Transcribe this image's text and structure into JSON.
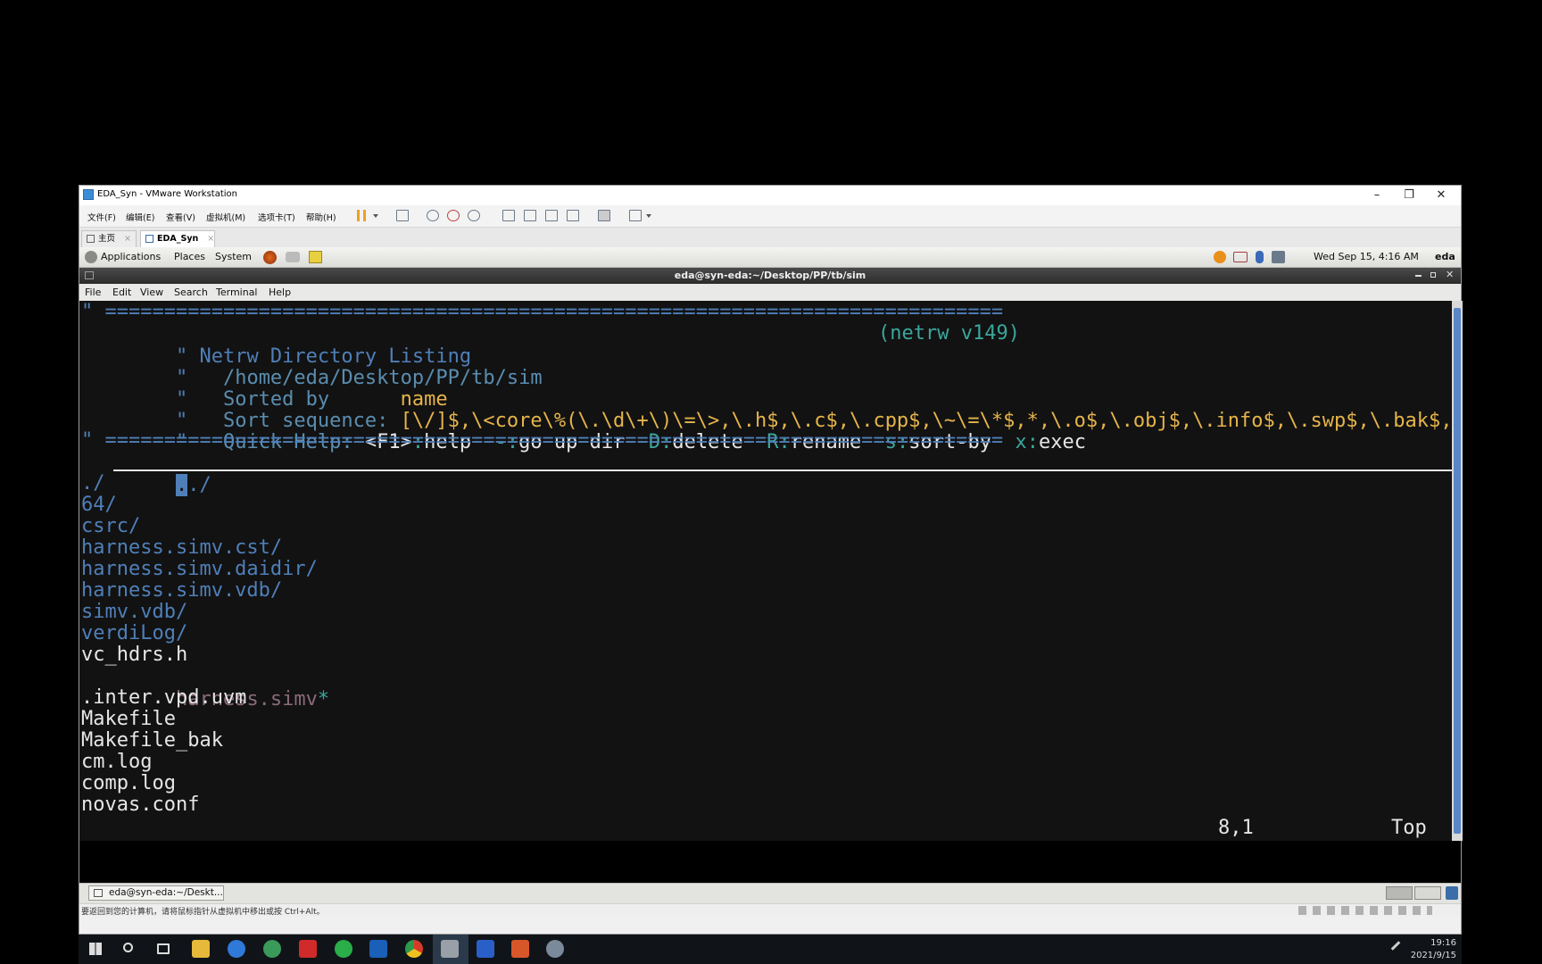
{
  "vmware": {
    "title": "EDA_Syn - VMware Workstation",
    "menu": [
      "文件(F)",
      "编辑(E)",
      "查看(V)",
      "虚拟机(M)",
      "选项卡(T)",
      "帮助(H)"
    ],
    "tabs": [
      {
        "label": "主页",
        "close": "×"
      },
      {
        "label": "EDA_Syn",
        "close": "×"
      }
    ],
    "window_buttons": {
      "minimize": "–",
      "restore": "❐",
      "close": "✕"
    },
    "status_text": "要返回到您的计算机，请将鼠标指针从虚拟机中移出或按 Ctrl+Alt。"
  },
  "gnome_panel": {
    "applications": "Applications",
    "places": "Places",
    "system": "System",
    "datetime": "Wed Sep 15, 4:16 AM",
    "user": "eda"
  },
  "terminal": {
    "title": "eda@syn-eda:~/Desktop/PP/tb/sim",
    "menu": [
      "File",
      "Edit",
      "View",
      "Search",
      "Terminal",
      "Help"
    ],
    "header": {
      "rule": "\" ============================================================================",
      "listing_title": "\" Netrw Directory Listing",
      "version": "(netrw v149)",
      "path_prefix": "\"   ",
      "path": "/home/eda/Desktop/PP/tb/sim",
      "sorted_prefix": "\"   ",
      "sorted_label": "Sorted by      ",
      "sorted_value": "name",
      "seq_prefix": "\"   ",
      "seq_label": "Sort sequence: ",
      "seq_value": "[\\/]$,\\<core\\%(\\.\\d\\+\\)\\=\\>,\\.h$,\\.c$,\\.cpp$,\\~\\=\\*$,*,\\.o$,\\.obj$,\\.info$,\\.swp$,\\.bak$,\\~$",
      "help_prefix": "\"   ",
      "help_label": "Quick Help: ",
      "help_items": [
        {
          "key": "<F1>",
          "sep": ":",
          "text": "help  "
        },
        {
          "key": "-",
          "sep": ":",
          "text": "go up dir  "
        },
        {
          "key": "D",
          "sep": ":",
          "text": "delete  "
        },
        {
          "key": "R",
          "sep": ":",
          "text": "rename  "
        },
        {
          "key": "s",
          "sep": ":",
          "text": "sort-by  "
        },
        {
          "key": "x",
          "sep": ":",
          "text": "exec"
        }
      ]
    },
    "current_line": {
      "cursor_char": ".",
      "rest": "./"
    },
    "entries": [
      {
        "name": "./",
        "kind": "dir"
      },
      {
        "name": "64/",
        "kind": "dir"
      },
      {
        "name": "csrc/",
        "kind": "dir"
      },
      {
        "name": "harness.simv.cst/",
        "kind": "dir"
      },
      {
        "name": "harness.simv.daidir/",
        "kind": "dir"
      },
      {
        "name": "harness.simv.vdb/",
        "kind": "dir"
      },
      {
        "name": "simv.vdb/",
        "kind": "dir"
      },
      {
        "name": "verdiLog/",
        "kind": "dir"
      },
      {
        "name": "vc_hdrs.h",
        "kind": "file"
      },
      {
        "name": "harness.simv",
        "kind": "exec",
        "suffix": "*"
      },
      {
        "name": ".inter.vpd.uvm",
        "kind": "file"
      },
      {
        "name": "Makefile",
        "kind": "file"
      },
      {
        "name": "Makefile_bak",
        "kind": "file"
      },
      {
        "name": "cm.log",
        "kind": "file"
      },
      {
        "name": "comp.log",
        "kind": "file"
      },
      {
        "name": "novas.conf",
        "kind": "file"
      }
    ],
    "ruler": {
      "position": "8,1",
      "scroll": "Top"
    }
  },
  "guest_taskbar": {
    "item": "eda@syn-eda:~/Deskt..."
  },
  "windows_clock": {
    "time": "19:16",
    "date": "2021/9/15"
  },
  "colors": {
    "dir": "#4f7fb8",
    "header": "#5a8db0",
    "value": "#e5b44a",
    "key": "#3ba69c",
    "exec": "#8a6a7a"
  }
}
